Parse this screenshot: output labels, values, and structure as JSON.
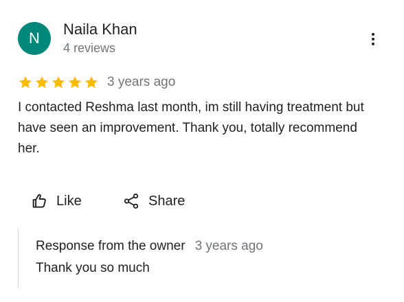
{
  "review": {
    "reviewer": {
      "initial": "N",
      "name": "Naila Khan",
      "review_count": "4 reviews",
      "avatar_color": "#00897b"
    },
    "menu_icon": "more-vert-icon",
    "rating": {
      "stars": 5,
      "max": 5,
      "star_color": "#fbbc04"
    },
    "date": "3 years ago",
    "text": "I contacted Reshma last month, im still having treatment but have seen an improvement. Thank you, totally recommend her.",
    "actions": {
      "like": {
        "label": "Like",
        "icon": "thumbs-up-icon"
      },
      "share": {
        "label": "Share",
        "icon": "share-icon"
      }
    },
    "owner_response": {
      "title": "Response from the owner",
      "date": "3 years ago",
      "text": "Thank you so much"
    }
  }
}
